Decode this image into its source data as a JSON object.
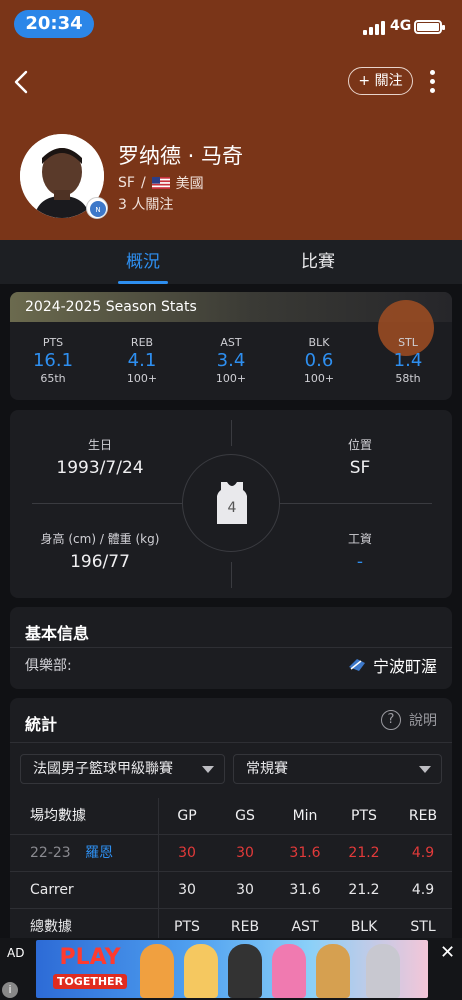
{
  "status_bar": {
    "time": "20:34",
    "network": "4G"
  },
  "header": {
    "follow_label": "+ 關注",
    "player_name": "罗纳德 · 马奇",
    "position": "SF",
    "separator": "/",
    "nationality": "美國",
    "followers": "3 人關注"
  },
  "tabs": [
    {
      "label": "概況",
      "active": true
    },
    {
      "label": "比賽",
      "active": false
    }
  ],
  "season_stats": {
    "title": "2024-2025 Season Stats",
    "items": [
      {
        "label": "PTS",
        "value": "16.1",
        "rank": "65th"
      },
      {
        "label": "REB",
        "value": "4.1",
        "rank": "100+"
      },
      {
        "label": "AST",
        "value": "3.4",
        "rank": "100+"
      },
      {
        "label": "BLK",
        "value": "0.6",
        "rank": "100+"
      },
      {
        "label": "STL",
        "value": "1.4",
        "rank": "58th"
      }
    ]
  },
  "bio": {
    "birthday_label": "生日",
    "birthday": "1993/7/24",
    "position_label": "位置",
    "position": "SF",
    "height_weight_label": "身高 (cm) / 體重 (kg)",
    "height_weight": "196/77",
    "salary_label": "工資",
    "salary": "-",
    "jersey_number": "4"
  },
  "basic_info": {
    "title": "基本信息",
    "club_label": "俱樂部:",
    "club": "宁波町渥"
  },
  "statistics": {
    "title": "統計",
    "help_label": "說明",
    "league_select": "法國男子籃球甲級聯賽",
    "season_type_select": "常規賽",
    "headers": [
      "場均數據",
      "GP",
      "GS",
      "Min",
      "PTS",
      "REB"
    ],
    "season_row": {
      "year": "22-23",
      "team": "羅恩",
      "values": [
        "30",
        "30",
        "31.6",
        "21.2",
        "4.9"
      ]
    },
    "career_row": {
      "label": "Carrer",
      "values": [
        "30",
        "30",
        "31.6",
        "21.2",
        "4.9"
      ]
    },
    "totals_row": {
      "label": "總數據",
      "values": [
        "PTS",
        "REB",
        "AST",
        "BLK",
        "STL"
      ]
    }
  },
  "ad": {
    "label": "AD",
    "close": "✕",
    "info": "i",
    "brand_top": "PLAY",
    "brand_bottom": "TOGETHER"
  },
  "colors": {
    "header_bg": "#7a3518",
    "accent": "#2e8ff0",
    "highlight": "#e23a3a"
  }
}
